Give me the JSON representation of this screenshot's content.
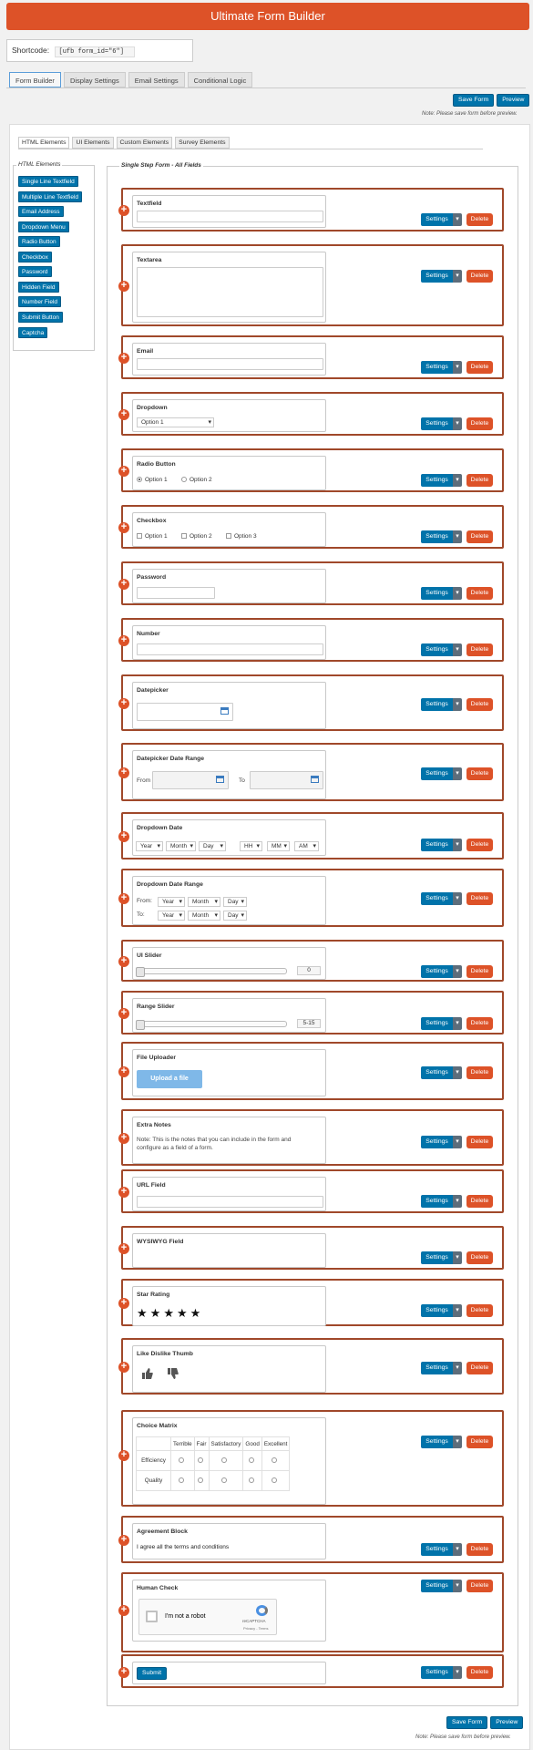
{
  "header": {
    "title": "Ultimate Form Builder"
  },
  "shortcode": {
    "label": "Shortcode:",
    "value": "[ufb form_id=\"6\"]"
  },
  "main_tabs": [
    "Form Builder",
    "Display Settings",
    "Email Settings",
    "Conditional Logic"
  ],
  "actions": {
    "save": "Save Form",
    "preview": "Preview",
    "note": "Note: Please save form before preview."
  },
  "sub_tabs": [
    "HTML Elements",
    "UI Elements",
    "Custom Elements",
    "Survey Elements"
  ],
  "palette": {
    "legend": "HTML Elements",
    "items": [
      "Single Line Textfield",
      "Multiple Line Textfield",
      "Email Address",
      "Dropdown Menu",
      "Radio Button",
      "Checkbox",
      "Password",
      "Hidden Field",
      "Number Field",
      "Submit Button",
      "Captcha"
    ]
  },
  "form": {
    "legend": "Single Step Form - All Fields",
    "settings_label": "Settings",
    "delete_label": "Delete",
    "fields": {
      "textfield": "Textfield",
      "textarea": "Textarea",
      "email": "Email",
      "dropdown": {
        "label": "Dropdown",
        "value": "Option 1"
      },
      "radio": {
        "label": "Radio Button",
        "options": [
          "Option 1",
          "Option 2"
        ],
        "selected": "Option 1"
      },
      "checkbox": {
        "label": "Checkbox",
        "options": [
          "Option 1",
          "Option 2",
          "Option 3"
        ]
      },
      "password": "Password",
      "number": "Number",
      "datepicker": "Datepicker",
      "daterange": {
        "label": "Datepicker Date Range",
        "from": "From",
        "to": "To"
      },
      "dropdown_date": {
        "label": "Dropdown Date",
        "year": "Year",
        "month": "Month",
        "day": "Day",
        "hh": "HH",
        "mm": "MM",
        "ampm": "AM"
      },
      "dropdown_range": {
        "label": "Dropdown Date Range",
        "from": "From:",
        "to": "To:",
        "year": "Year",
        "month": "Month",
        "day": "Day"
      },
      "ui_slider": {
        "label": "UI Slider",
        "value": "0"
      },
      "range_slider": {
        "label": "Range Slider",
        "value": "5-15"
      },
      "file": {
        "label": "File Uploader",
        "button": "Upload a file"
      },
      "notes": {
        "label": "Extra Notes",
        "line1": "Note: This is the notes that you can include in the form and",
        "line2": "configure as a field of a form."
      },
      "url": "URL Field",
      "wysiwyg": "WYSIWYG Field",
      "star": {
        "label": "Star Rating",
        "stars": 5
      },
      "thumb": "Like Dislike Thumb",
      "matrix": {
        "label": "Choice Matrix",
        "columns": [
          "Terrible",
          "Fair",
          "Satisfactory",
          "Good",
          "Excellent"
        ],
        "rows": [
          "Efficiency",
          "Quality"
        ]
      },
      "agreement": {
        "label": "Agreement Block",
        "text": "I agree all the terms and conditions"
      },
      "captcha": {
        "label": "Human Check",
        "robot": "I'm not a robot",
        "brand": "reCAPTCHA",
        "links": "Privacy - Terms"
      },
      "submit": "Submit"
    }
  },
  "colors": {
    "brand": "#dd5228",
    "primary": "#0073aa",
    "field_border": "#a0482a"
  }
}
